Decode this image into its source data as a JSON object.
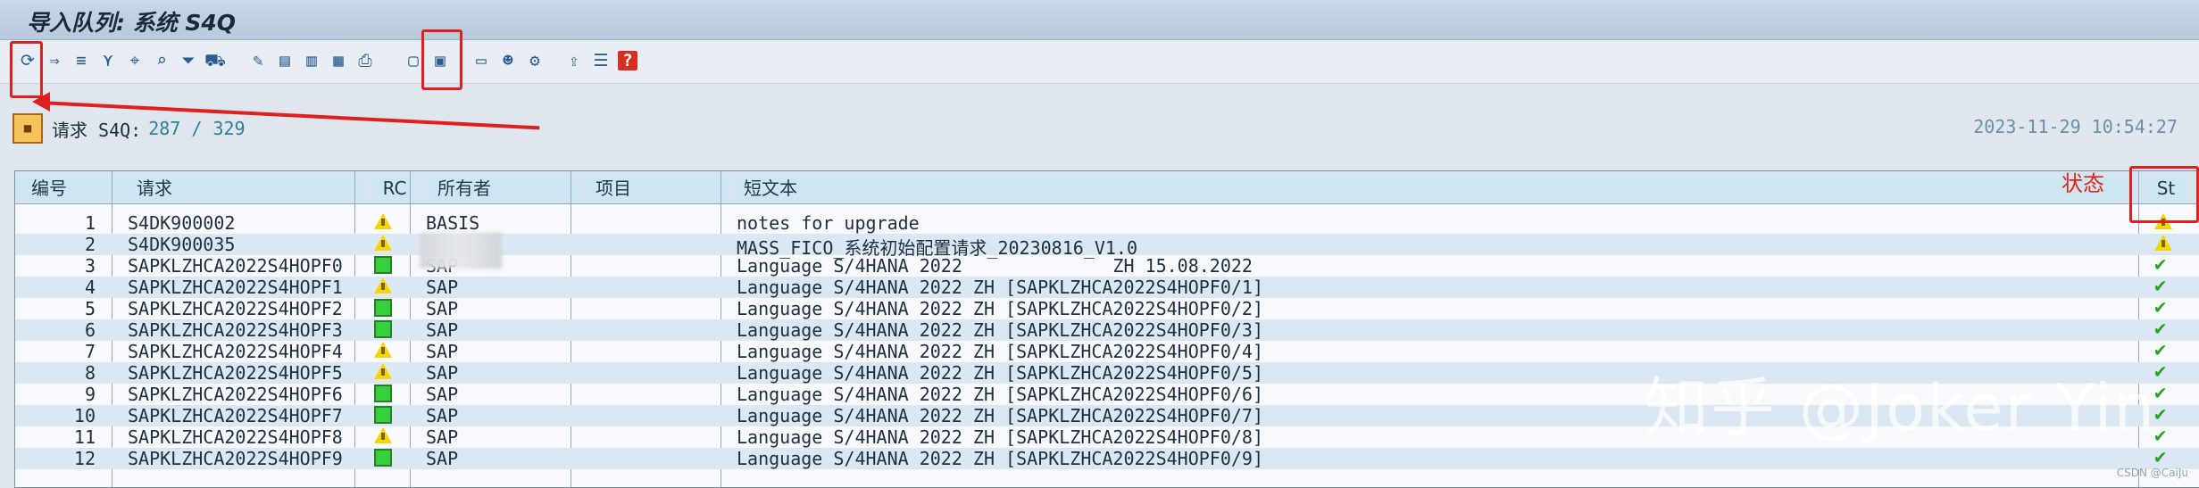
{
  "window": {
    "title": "导入队列: 系统 S4Q"
  },
  "toolbar": {
    "icons": [
      {
        "name": "refresh-icon",
        "glyph": "⟳"
      },
      {
        "name": "import-icon",
        "glyph": "⇒"
      },
      {
        "name": "transport-icon",
        "glyph": "≡"
      },
      {
        "name": "filter-icon",
        "glyph": "⋎"
      },
      {
        "name": "select-icon",
        "glyph": "⌖"
      },
      {
        "name": "search-icon",
        "glyph": "⌕"
      },
      {
        "name": "funnel-icon",
        "glyph": "⏷"
      },
      {
        "name": "truck-icon",
        "glyph": "⛟"
      },
      {
        "name": "edit-icon",
        "glyph": "✎"
      },
      {
        "name": "document-icon",
        "glyph": "▤"
      },
      {
        "name": "doc-list-icon",
        "glyph": "▥"
      },
      {
        "name": "truck-doc-icon",
        "glyph": "▦"
      },
      {
        "name": "print-icon",
        "glyph": "⎙"
      },
      {
        "name": "lock-icon",
        "glyph": "🔒"
      },
      {
        "name": "transport-request-icon",
        "glyph": "▣"
      },
      {
        "name": "monitor-icon",
        "glyph": "▭"
      },
      {
        "name": "user-icon",
        "glyph": "☻"
      },
      {
        "name": "settings-icon",
        "glyph": "⚙"
      },
      {
        "name": "export-icon",
        "glyph": "⇪"
      },
      {
        "name": "list-icon",
        "glyph": "☰"
      },
      {
        "name": "help-icon",
        "glyph": "?"
      }
    ]
  },
  "summary": {
    "label": "请求 S4Q:",
    "count": "287 / 329",
    "timestamp": "2023-11-29 10:54:27"
  },
  "table": {
    "headers": {
      "num": "编号",
      "request": "请求",
      "rc": "RC",
      "owner": "所有者",
      "project": "项目",
      "short_text": "短文本",
      "status": "St"
    },
    "rows": [
      {
        "num": "1",
        "request": "S4DK900002",
        "owner": "BASIS",
        "text": "notes for upgrade",
        "rc": "warning",
        "status": "warning"
      },
      {
        "num": "2",
        "request": "S4DK900035",
        "owner": "",
        "text": "MASS_FICO_系统初始配置请求_20230816_V1.0",
        "rc": "warning",
        "status": "warning"
      },
      {
        "num": "3",
        "request": "SAPKLZHCA2022S4HOPF0",
        "owner": "SAP",
        "text": "Language S/4HANA 2022              ZH 15.08.2022",
        "rc": "ok",
        "status": "check"
      },
      {
        "num": "4",
        "request": "SAPKLZHCA2022S4HOPF1",
        "owner": "SAP",
        "text": "Language S/4HANA 2022 ZH [SAPKLZHCA2022S4HOPF0/1]",
        "rc": "warning",
        "status": "check"
      },
      {
        "num": "5",
        "request": "SAPKLZHCA2022S4HOPF2",
        "owner": "SAP",
        "text": "Language S/4HANA 2022 ZH [SAPKLZHCA2022S4HOPF0/2]",
        "rc": "ok",
        "status": "check"
      },
      {
        "num": "6",
        "request": "SAPKLZHCA2022S4HOPF3",
        "owner": "SAP",
        "text": "Language S/4HANA 2022 ZH [SAPKLZHCA2022S4HOPF0/3]",
        "rc": "ok",
        "status": "check"
      },
      {
        "num": "7",
        "request": "SAPKLZHCA2022S4HOPF4",
        "owner": "SAP",
        "text": "Language S/4HANA 2022 ZH [SAPKLZHCA2022S4HOPF0/4]",
        "rc": "warning",
        "status": "check"
      },
      {
        "num": "8",
        "request": "SAPKLZHCA2022S4HOPF5",
        "owner": "SAP",
        "text": "Language S/4HANA 2022 ZH [SAPKLZHCA2022S4HOPF0/5]",
        "rc": "warning",
        "status": "check"
      },
      {
        "num": "9",
        "request": "SAPKLZHCA2022S4HOPF6",
        "owner": "SAP",
        "text": "Language S/4HANA 2022 ZH [SAPKLZHCA2022S4HOPF0/6]",
        "rc": "ok",
        "status": "check"
      },
      {
        "num": "10",
        "request": "SAPKLZHCA2022S4HOPF7",
        "owner": "SAP",
        "text": "Language S/4HANA 2022 ZH [SAPKLZHCA2022S4HOPF0/7]",
        "rc": "ok",
        "status": "check"
      },
      {
        "num": "11",
        "request": "SAPKLZHCA2022S4HOPF8",
        "owner": "SAP",
        "text": "Language S/4HANA 2022 ZH [SAPKLZHCA2022S4HOPF0/8]",
        "rc": "warning",
        "status": "check"
      },
      {
        "num": "12",
        "request": "SAPKLZHCA2022S4HOPF9",
        "owner": "SAP",
        "text": "Language S/4HANA 2022 ZH [SAPKLZHCA2022S4HOPF0/9]",
        "rc": "ok",
        "status": "check"
      }
    ]
  },
  "annotations": {
    "status_label": "状态",
    "watermark": "知乎 @Joker Yin",
    "source": "CSDN @CaiJu"
  },
  "colors": {
    "highlight": "#e02020",
    "warning": "#f2d800",
    "success": "#33d03b"
  }
}
